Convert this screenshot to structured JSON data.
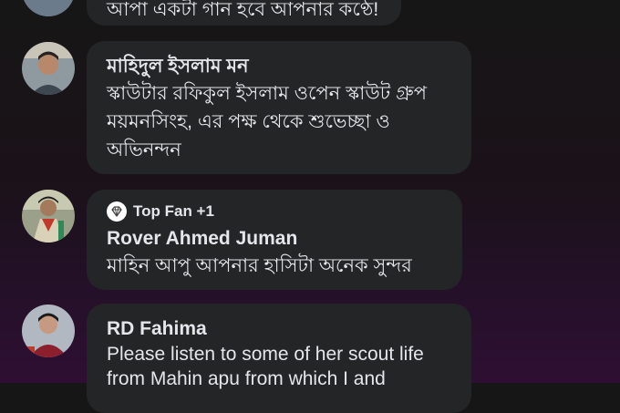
{
  "comments": [
    {
      "name": "",
      "text": "আপা একটা গান হবে আপনার কণ্ঠে!"
    },
    {
      "name": "মাহিদুল ইসলাম মন",
      "text": "স্কাউটার রফিকুল ইসলাম ওপেন স্কাউট গ্রুপ ময়মনসিংহ, এর পক্ষ থেকে শুভেচ্ছা ও  অভিনন্দন"
    },
    {
      "badge": "Top Fan +1",
      "badge_icon": "diamond-icon",
      "name": "Rover Ahmed Juman",
      "text": "মাহিন আপু আপনার হাসিটা অনেক সুন্দর"
    },
    {
      "name": "RD Fahima",
      "text": "Please listen to some of her scout life from Mahin apu from which I and"
    }
  ]
}
